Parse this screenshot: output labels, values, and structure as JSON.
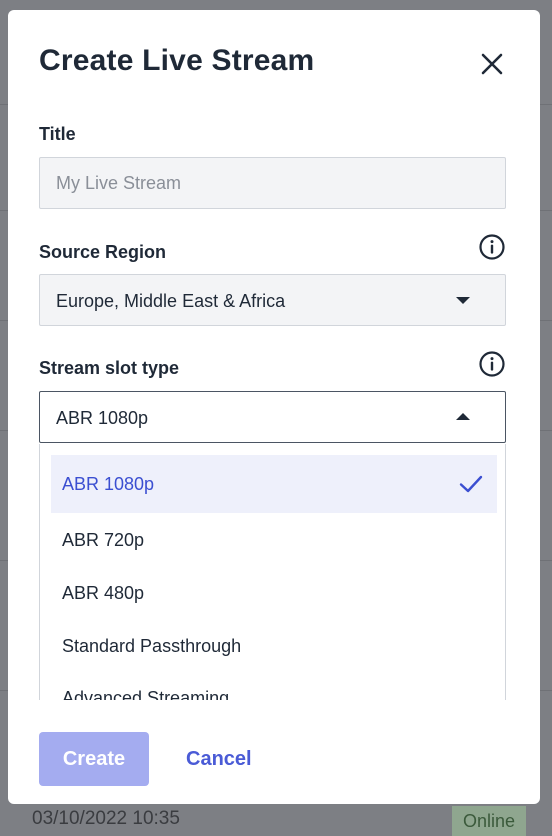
{
  "background": {
    "timestamp": "03/10/2022 10:35",
    "status_badge": "Online"
  },
  "modal": {
    "title": "Create Live Stream",
    "close_icon": "close-icon",
    "title_field": {
      "label": "Title",
      "placeholder": "My Live Stream",
      "value": ""
    },
    "source_region": {
      "label": "Source Region",
      "info_icon": "info-icon",
      "selected": "Europe, Middle East & Africa"
    },
    "stream_slot_type": {
      "label": "Stream slot type",
      "info_icon": "info-icon",
      "selected": "ABR 1080p",
      "options": [
        "ABR 1080p",
        "ABR 720p",
        "ABR 480p",
        "Standard Passthrough",
        "Advanced Streaming"
      ]
    },
    "buttons": {
      "create": "Create",
      "cancel": "Cancel"
    }
  },
  "colors": {
    "accent": "#3b4fd1",
    "accent_disabled": "#a4acf0",
    "selected_bg": "#eef0fb"
  }
}
